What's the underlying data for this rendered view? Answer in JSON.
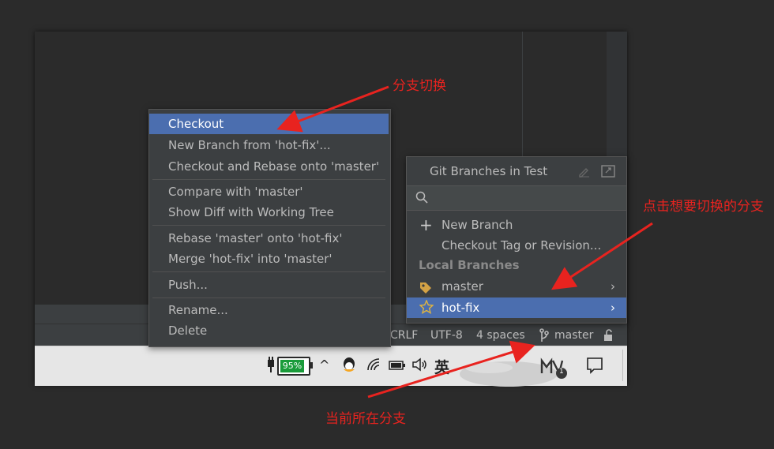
{
  "context_menu": {
    "items": [
      {
        "label": "Checkout"
      },
      {
        "label": "New Branch from 'hot-fix'..."
      },
      {
        "label": "Checkout and Rebase onto 'master'"
      },
      {
        "label": "Compare with 'master'"
      },
      {
        "label": "Show Diff with Working Tree"
      },
      {
        "label": "Rebase 'master' onto 'hot-fix'"
      },
      {
        "label": "Merge 'hot-fix' into 'master'"
      },
      {
        "label": "Push..."
      },
      {
        "label": "Rename..."
      },
      {
        "label": "Delete"
      }
    ]
  },
  "git_popup": {
    "title": "Git Branches in Test",
    "search_placeholder": "",
    "actions": [
      {
        "label": "New Branch",
        "icon": "plus-icon"
      },
      {
        "label": "Checkout Tag or Revision...",
        "icon": ""
      }
    ],
    "section_header": "Local Branches",
    "branches": [
      {
        "label": "master",
        "icon": "tag-icon"
      },
      {
        "label": "hot-fix",
        "icon": "star-icon"
      }
    ]
  },
  "status_bar": {
    "line_separator": "CRLF",
    "encoding": "UTF-8",
    "indent": "4 spaces",
    "branch": "master"
  },
  "taskbar": {
    "battery": "95%",
    "ime": "英",
    "notification_count": "1"
  },
  "annotations": {
    "switch_branch": "分支切换",
    "click_branch": "点击想要切换的分支",
    "current_branch": "当前所在分支"
  },
  "colors": {
    "selection": "#4b6eaf",
    "annotation": "#e8231f",
    "battery": "#1a9b3a"
  }
}
